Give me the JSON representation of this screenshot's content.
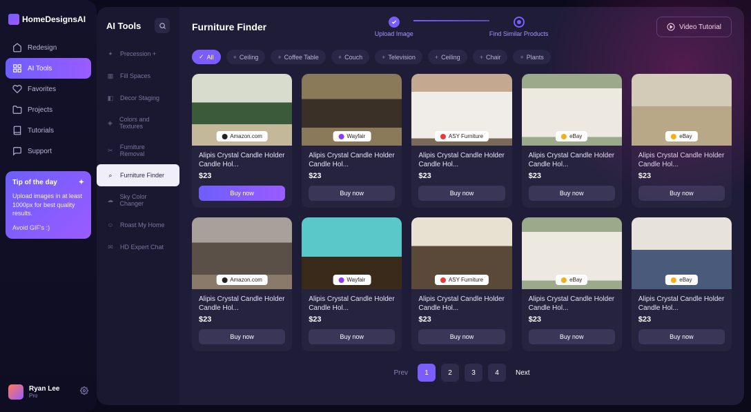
{
  "brand": "HomeDesignsAI",
  "sidebar1": {
    "items": [
      {
        "label": "Redesign",
        "icon": "home"
      },
      {
        "label": "AI Tools",
        "icon": "grid",
        "active": true
      },
      {
        "label": "Favorites",
        "icon": "heart"
      },
      {
        "label": "Projects",
        "icon": "folder"
      },
      {
        "label": "Tutorials",
        "icon": "book"
      },
      {
        "label": "Support",
        "icon": "chat"
      }
    ]
  },
  "tip": {
    "title": "Tip of the day",
    "body": "Upload images in at least 1000px for best quality results.",
    "footer": "Avoid GIF's :)"
  },
  "user": {
    "name": "Ryan Lee",
    "plan": "Pro"
  },
  "sidebar2": {
    "title": "AI Tools",
    "items": [
      {
        "label": "Precession +"
      },
      {
        "label": "Fill Spaces"
      },
      {
        "label": "Decor Staging"
      },
      {
        "label": "Colors and Textures"
      },
      {
        "label": "Furniture Removal"
      },
      {
        "label": "Furniture Finder",
        "active": true
      },
      {
        "label": "Sky Color Changer"
      },
      {
        "label": "Roast My Home"
      },
      {
        "label": "HD Expert Chat"
      }
    ]
  },
  "page": {
    "title": "Furniture Finder",
    "steps": [
      {
        "label": "Upload Image",
        "done": true
      },
      {
        "label": "Find Similar Products",
        "done": false
      }
    ],
    "video_btn": "Video Tutorial"
  },
  "chips": [
    {
      "label": "All",
      "active": true
    },
    {
      "label": "Ceiling"
    },
    {
      "label": "Coffee Table"
    },
    {
      "label": "Couch"
    },
    {
      "label": "Television"
    },
    {
      "label": "Ceiling"
    },
    {
      "label": "Chair"
    },
    {
      "label": "Plants"
    }
  ],
  "products": [
    {
      "title": "Alipis Crystal Candle Holder Candle Hol...",
      "price": "$23",
      "source": "Amazon.com",
      "src_color": "#222",
      "bg": "bg-kitchen1",
      "primary": true
    },
    {
      "title": "Alipis Crystal Candle Holder Candle Hol...",
      "price": "$23",
      "source": "Wayfair",
      "src_color": "#8a3cff",
      "bg": "bg-kitchen2"
    },
    {
      "title": "Alipis Crystal Candle Holder Candle Hol...",
      "price": "$23",
      "source": "ASY Furniture",
      "src_color": "#e63c3c",
      "bg": "bg-cabinet"
    },
    {
      "title": "Alipis Crystal Candle Holder Candle Hol...",
      "price": "$23",
      "source": "eBay",
      "src_color": "#f5af19",
      "bg": "bg-cabinet2"
    },
    {
      "title": "Alipis Crystal Candle Holder Candle Hol...",
      "price": "$23",
      "source": "eBay",
      "src_color": "#f5af19",
      "bg": "bg-sofa"
    },
    {
      "title": "Alipis Crystal Candle Holder Candle Hol...",
      "price": "$23",
      "source": "Amazon.com",
      "src_color": "#222",
      "bg": "bg-bed"
    },
    {
      "title": "Alipis Crystal Candle Holder Candle Hol...",
      "price": "$23",
      "source": "Wayfair",
      "src_color": "#8a3cff",
      "bg": "bg-desk"
    },
    {
      "title": "Alipis Crystal Candle Holder Candle Hol...",
      "price": "$23",
      "source": "ASY Furniture",
      "src_color": "#e63c3c",
      "bg": "bg-bed2"
    },
    {
      "title": "Alipis Crystal Candle Holder Candle Hol...",
      "price": "$23",
      "source": "eBay",
      "src_color": "#f5af19",
      "bg": "bg-cabinet2"
    },
    {
      "title": "Alipis Crystal Candle Holder Candle Hol...",
      "price": "$23",
      "source": "eBay",
      "src_color": "#f5af19",
      "bg": "bg-sofa2"
    }
  ],
  "buy_label": "Buy now",
  "pagination": {
    "prev": "Prev",
    "pages": [
      "1",
      "2",
      "3",
      "4"
    ],
    "active": "1",
    "next": "Next"
  }
}
